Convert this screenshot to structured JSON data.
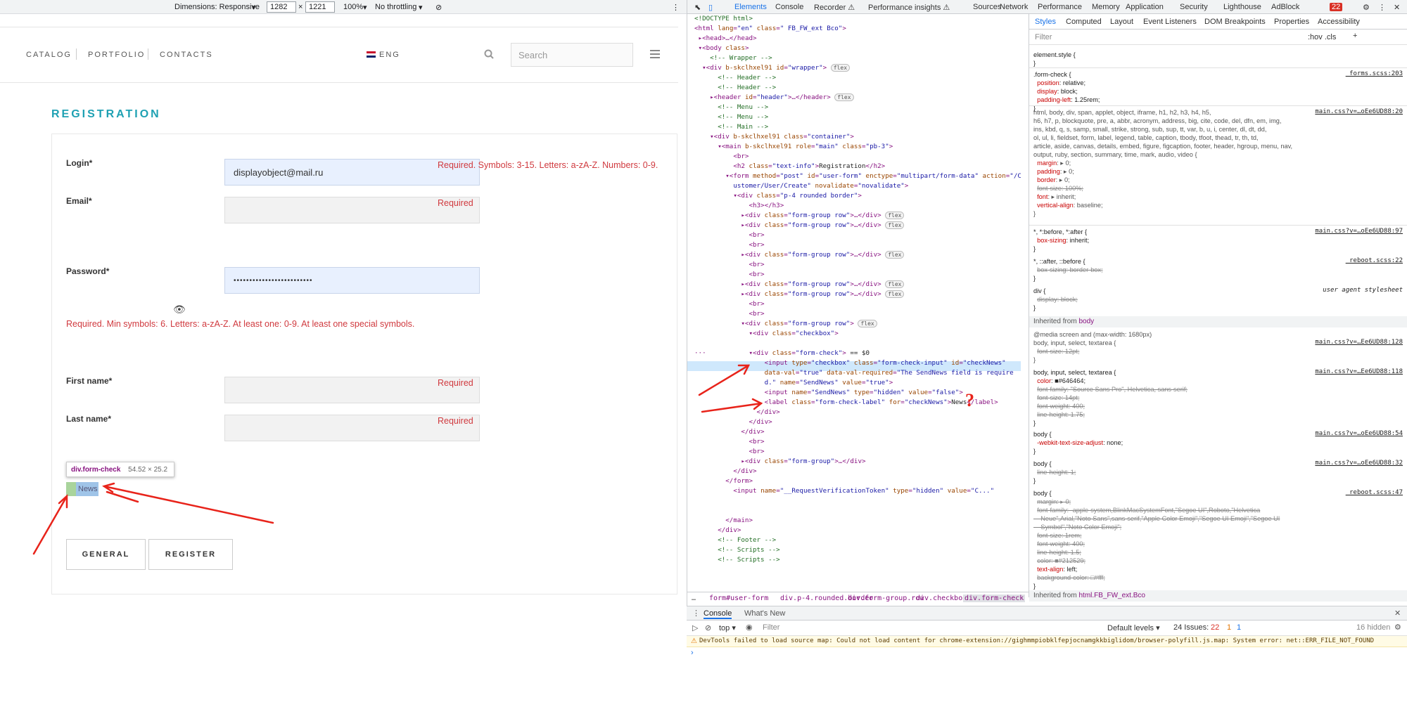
{
  "device_toolbar": {
    "dimensions_label": "Dimensions: Responsive",
    "width": "1282",
    "height": "1221",
    "times": "×",
    "zoom": "100%",
    "throttle": "No throttling"
  },
  "site_nav": {
    "items": [
      "CATALOG",
      "PORTFOLIO",
      "CONTACTS"
    ],
    "lang": "ENG",
    "search_placeholder": "Search"
  },
  "form": {
    "title": "REGISTRATION",
    "login_label": "Login*",
    "login_value": "displayobject@mail.ru",
    "login_error": "Required. Symbols: 3-15. Letters: a-zA-Z. Numbers: 0-9.",
    "email_label": "Email*",
    "email_error": "Required",
    "password_label": "Password*",
    "password_value": "•••••••••••••••••••••••••",
    "password_error": "Required. Min symbols: 6. Letters: a-zA-Z. At least one: 0-9. At least one special symbols.",
    "firstname_label": "First name*",
    "firstname_error": "Required",
    "lastname_label": "Last name*",
    "lastname_error": "Required",
    "news_label": "News",
    "tooltip_selector": "div.form-check",
    "tooltip_size": "54.52 × 25.2",
    "general_button": "GENERAL",
    "register_button": "REGISTER"
  },
  "devtools": {
    "tabs": [
      "Elements",
      "Console",
      "Recorder ⚠",
      "Performance insights ⚠",
      "Sources",
      "Network",
      "Performance",
      "Memory",
      "Application",
      "Security",
      "Lighthouse",
      "AdBlock"
    ],
    "issue_count": "22",
    "styles_tabs": [
      "Styles",
      "Computed",
      "Layout",
      "Event Listeners",
      "DOM Breakpoints",
      "Properties",
      "Accessibility"
    ],
    "filter_placeholder": "Filter",
    "hov_cls": ":hov  .cls",
    "breadcrumbs": [
      "form#user-form",
      "div.p-4.rounded.border",
      "div.form-group.row",
      "div.checkbox",
      "div.form-check"
    ],
    "inherited_from": "Inherited from",
    "inherited_html": "html.FB_FW_ext.Bco",
    "inherited_body_label": "Inherited from",
    "inherited_body": "body",
    "console_tabs": [
      "Console",
      "What's New"
    ],
    "console_context": "top ▾",
    "console_filter": "Filter",
    "console_levels": "Default levels ▾",
    "console_issues": "24 Issues:",
    "console_issue_red": "22",
    "console_issue_yellow": "1",
    "console_issue_blue": "1",
    "console_hidden": "16 hidden",
    "console_warning": "DevTools failed to load source map: Could not load content for chrome-extension://gighmmpiobklfepjocnamgkkbiglidom/browser-polyfill.js.map: System error: net::ERR_FILE_NOT_FOUND",
    "question_mark": "?"
  },
  "colors": {
    "accent": "#1fa1b3",
    "error": "#d0393e",
    "devtools_blue": "#1a73e8",
    "annotation_red": "#e8231a"
  }
}
